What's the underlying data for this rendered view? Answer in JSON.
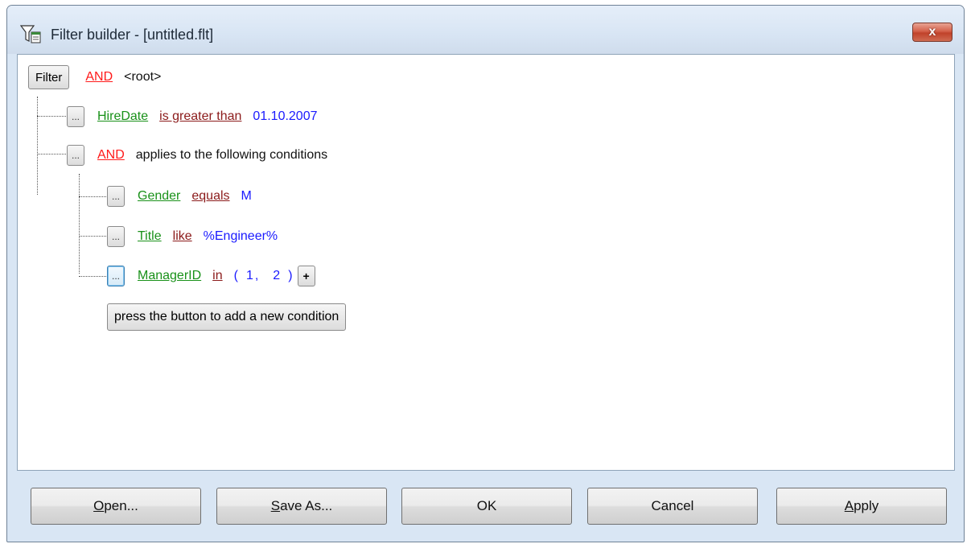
{
  "window": {
    "title": "Filter builder - [untitled.flt]",
    "close_label": "x"
  },
  "tree": {
    "root": {
      "filter_button": "Filter",
      "operator": "AND",
      "label": "<root>"
    },
    "nodes": [
      {
        "button": "...",
        "field": "HireDate",
        "operator": "is greater than",
        "value": "01.10.2007"
      },
      {
        "button": "...",
        "group_operator": "AND",
        "text": "applies to the following conditions"
      },
      {
        "button": "...",
        "field": "Gender",
        "operator": "equals",
        "value": "M"
      },
      {
        "button": "...",
        "field": "Title",
        "operator": "like",
        "value": "%Engineer%"
      },
      {
        "button": "...",
        "field": "ManagerID",
        "operator": "in",
        "value_open": "(",
        "value_1": "1",
        "value_sep": ",",
        "value_2": "2",
        "value_close": ")",
        "plus": "+"
      }
    ],
    "add_condition_label": "press the button to add a new condition"
  },
  "buttons": {
    "open": {
      "first": "O",
      "rest": "pen..."
    },
    "save_as": {
      "first": "S",
      "rest": "ave As..."
    },
    "ok": "OK",
    "cancel": "Cancel",
    "apply": {
      "first": "A",
      "rest": "pply"
    }
  },
  "colors": {
    "and_keyword": "#ff1a1a",
    "field": "#199119",
    "operator": "#8b1a1a",
    "value": "#1a1aff"
  }
}
